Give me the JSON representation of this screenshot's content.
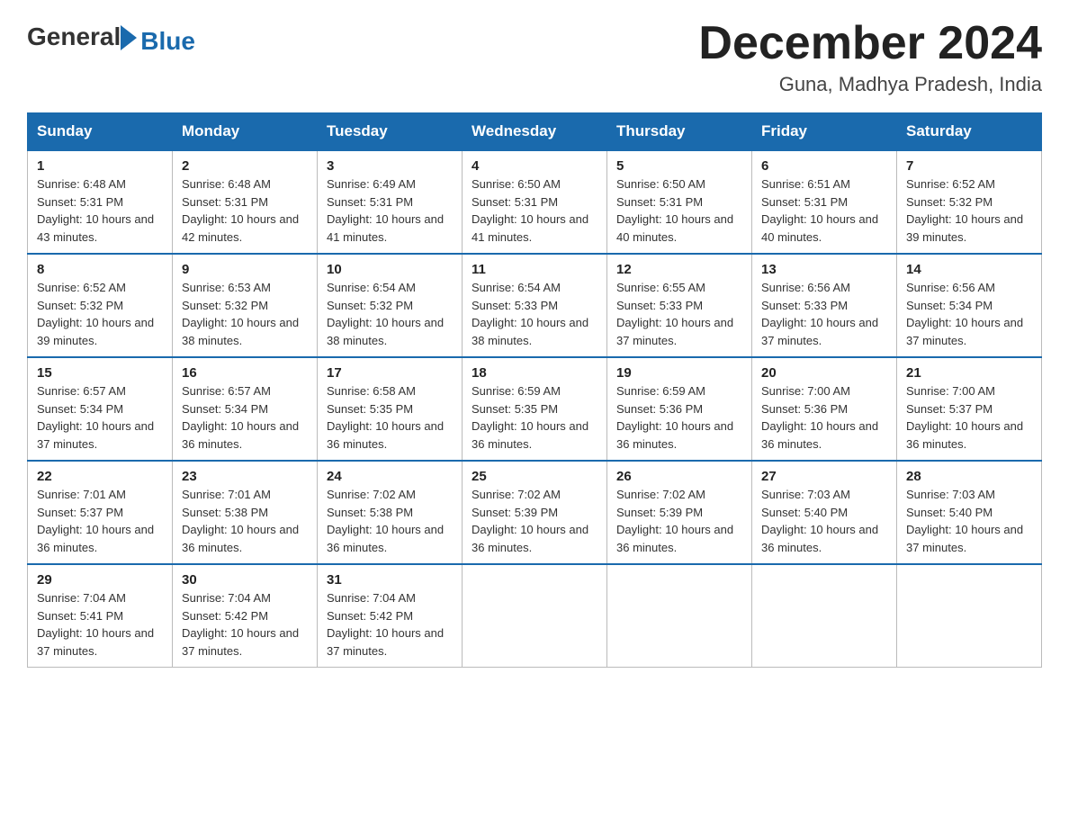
{
  "header": {
    "logo_general": "General",
    "logo_blue": "Blue",
    "month_title": "December 2024",
    "location": "Guna, Madhya Pradesh, India"
  },
  "weekdays": [
    "Sunday",
    "Monday",
    "Tuesday",
    "Wednesday",
    "Thursday",
    "Friday",
    "Saturday"
  ],
  "weeks": [
    [
      {
        "day": "1",
        "sunrise": "6:48 AM",
        "sunset": "5:31 PM",
        "daylight": "10 hours and 43 minutes."
      },
      {
        "day": "2",
        "sunrise": "6:48 AM",
        "sunset": "5:31 PM",
        "daylight": "10 hours and 42 minutes."
      },
      {
        "day": "3",
        "sunrise": "6:49 AM",
        "sunset": "5:31 PM",
        "daylight": "10 hours and 41 minutes."
      },
      {
        "day": "4",
        "sunrise": "6:50 AM",
        "sunset": "5:31 PM",
        "daylight": "10 hours and 41 minutes."
      },
      {
        "day": "5",
        "sunrise": "6:50 AM",
        "sunset": "5:31 PM",
        "daylight": "10 hours and 40 minutes."
      },
      {
        "day": "6",
        "sunrise": "6:51 AM",
        "sunset": "5:31 PM",
        "daylight": "10 hours and 40 minutes."
      },
      {
        "day": "7",
        "sunrise": "6:52 AM",
        "sunset": "5:32 PM",
        "daylight": "10 hours and 39 minutes."
      }
    ],
    [
      {
        "day": "8",
        "sunrise": "6:52 AM",
        "sunset": "5:32 PM",
        "daylight": "10 hours and 39 minutes."
      },
      {
        "day": "9",
        "sunrise": "6:53 AM",
        "sunset": "5:32 PM",
        "daylight": "10 hours and 38 minutes."
      },
      {
        "day": "10",
        "sunrise": "6:54 AM",
        "sunset": "5:32 PM",
        "daylight": "10 hours and 38 minutes."
      },
      {
        "day": "11",
        "sunrise": "6:54 AM",
        "sunset": "5:33 PM",
        "daylight": "10 hours and 38 minutes."
      },
      {
        "day": "12",
        "sunrise": "6:55 AM",
        "sunset": "5:33 PM",
        "daylight": "10 hours and 37 minutes."
      },
      {
        "day": "13",
        "sunrise": "6:56 AM",
        "sunset": "5:33 PM",
        "daylight": "10 hours and 37 minutes."
      },
      {
        "day": "14",
        "sunrise": "6:56 AM",
        "sunset": "5:34 PM",
        "daylight": "10 hours and 37 minutes."
      }
    ],
    [
      {
        "day": "15",
        "sunrise": "6:57 AM",
        "sunset": "5:34 PM",
        "daylight": "10 hours and 37 minutes."
      },
      {
        "day": "16",
        "sunrise": "6:57 AM",
        "sunset": "5:34 PM",
        "daylight": "10 hours and 36 minutes."
      },
      {
        "day": "17",
        "sunrise": "6:58 AM",
        "sunset": "5:35 PM",
        "daylight": "10 hours and 36 minutes."
      },
      {
        "day": "18",
        "sunrise": "6:59 AM",
        "sunset": "5:35 PM",
        "daylight": "10 hours and 36 minutes."
      },
      {
        "day": "19",
        "sunrise": "6:59 AM",
        "sunset": "5:36 PM",
        "daylight": "10 hours and 36 minutes."
      },
      {
        "day": "20",
        "sunrise": "7:00 AM",
        "sunset": "5:36 PM",
        "daylight": "10 hours and 36 minutes."
      },
      {
        "day": "21",
        "sunrise": "7:00 AM",
        "sunset": "5:37 PM",
        "daylight": "10 hours and 36 minutes."
      }
    ],
    [
      {
        "day": "22",
        "sunrise": "7:01 AM",
        "sunset": "5:37 PM",
        "daylight": "10 hours and 36 minutes."
      },
      {
        "day": "23",
        "sunrise": "7:01 AM",
        "sunset": "5:38 PM",
        "daylight": "10 hours and 36 minutes."
      },
      {
        "day": "24",
        "sunrise": "7:02 AM",
        "sunset": "5:38 PM",
        "daylight": "10 hours and 36 minutes."
      },
      {
        "day": "25",
        "sunrise": "7:02 AM",
        "sunset": "5:39 PM",
        "daylight": "10 hours and 36 minutes."
      },
      {
        "day": "26",
        "sunrise": "7:02 AM",
        "sunset": "5:39 PM",
        "daylight": "10 hours and 36 minutes."
      },
      {
        "day": "27",
        "sunrise": "7:03 AM",
        "sunset": "5:40 PM",
        "daylight": "10 hours and 36 minutes."
      },
      {
        "day": "28",
        "sunrise": "7:03 AM",
        "sunset": "5:40 PM",
        "daylight": "10 hours and 37 minutes."
      }
    ],
    [
      {
        "day": "29",
        "sunrise": "7:04 AM",
        "sunset": "5:41 PM",
        "daylight": "10 hours and 37 minutes."
      },
      {
        "day": "30",
        "sunrise": "7:04 AM",
        "sunset": "5:42 PM",
        "daylight": "10 hours and 37 minutes."
      },
      {
        "day": "31",
        "sunrise": "7:04 AM",
        "sunset": "5:42 PM",
        "daylight": "10 hours and 37 minutes."
      },
      null,
      null,
      null,
      null
    ]
  ]
}
